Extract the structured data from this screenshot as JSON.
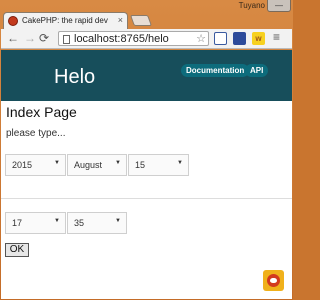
{
  "window": {
    "user": "Tuyano",
    "controls_glyph": "—"
  },
  "tab": {
    "title": "CakePHP: the rapid dev",
    "close_glyph": "×"
  },
  "toolbar": {
    "back_glyph": "←",
    "forward_glyph": "→",
    "reload_glyph": "⟳",
    "home_glyph": "⌂",
    "url": "localhost:8765/helo",
    "star_glyph": "☆",
    "ext3_label": "w",
    "menu_glyph": "≡"
  },
  "site": {
    "brand": "Helo",
    "nav": [
      "Documentation",
      "API"
    ]
  },
  "page": {
    "title": "Index Page",
    "text": "please type...",
    "date": {
      "year": "2015",
      "month": "August",
      "day": "15"
    },
    "time": {
      "hour": "17",
      "minute": "35"
    },
    "submit_label": "OK",
    "select_arrow": "▼"
  },
  "icons": {
    "tab_favicon": "cakephp-favicon-icon",
    "page": "page-icon",
    "bottom_right": "cakephp-icon"
  },
  "colors": {
    "header_bg": "#174e5b",
    "nav_pill": "#0d6c7c",
    "window_frame": "#c9752f"
  }
}
